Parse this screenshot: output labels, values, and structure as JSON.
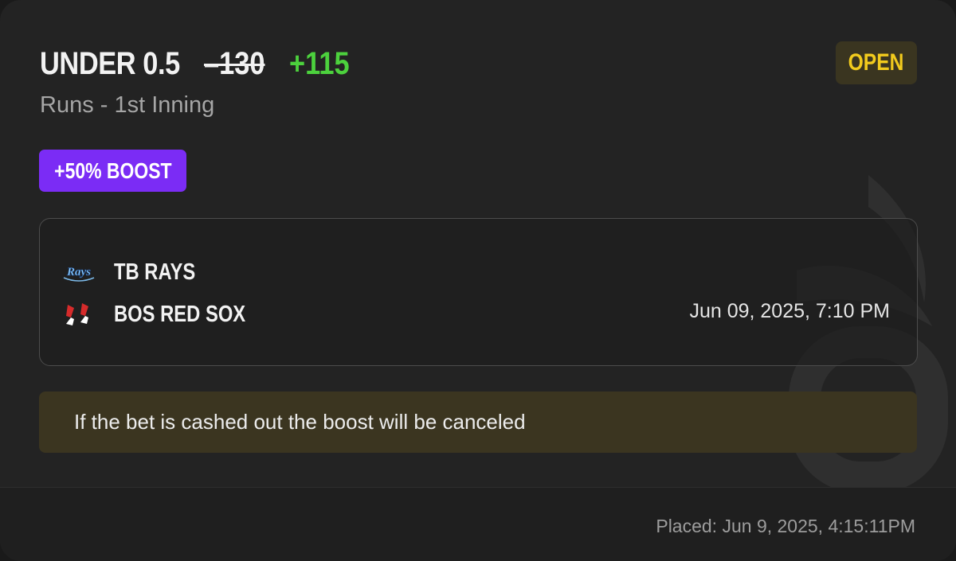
{
  "bet": {
    "title": "UNDER 0.5",
    "odds_original": "–130",
    "odds_boosted": "+115",
    "market": "Runs - 1st Inning",
    "status": "OPEN",
    "boost_label": "+50% BOOST"
  },
  "game": {
    "away_team": "TB RAYS",
    "home_team": "BOS RED SOX",
    "away_logo_text": "Rays",
    "datetime": "Jun 09, 2025, 7:10 PM"
  },
  "notice": {
    "text": "If the bet is cashed out the boost will be canceled"
  },
  "footer": {
    "placed": "Placed: Jun 9, 2025, 4:15:11PM"
  },
  "colors": {
    "odds_boosted": "#4cd13d",
    "status_text": "#f2cb1d",
    "status_bg": "#3a3520",
    "boost_bg": "#7b2cf5",
    "notice_bg": "#3b3520",
    "card_bg": "#232323"
  },
  "icons": {
    "away_logo": "rays-logo-icon",
    "home_logo": "red-sox-logo-icon",
    "watermark": "brand-watermark-icon"
  }
}
